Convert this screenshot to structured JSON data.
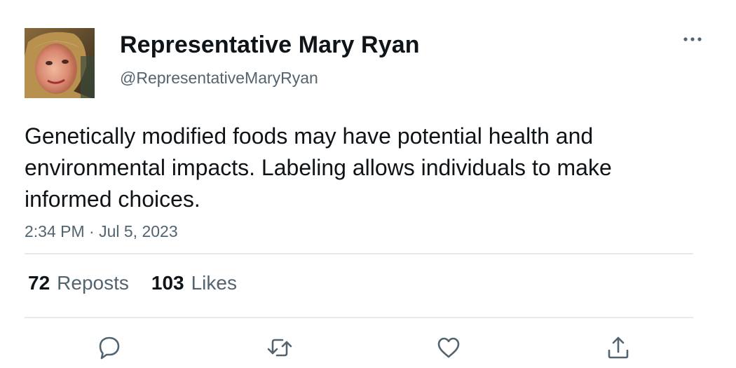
{
  "author": {
    "display_name": "Representative Mary Ryan",
    "handle": "@RepresentativeMaryRyan"
  },
  "tweet": {
    "text": "Genetically modified foods may have potential health and environmental impacts. Labeling allows individuals to make informed choices.",
    "timestamp": "2:34 PM · Jul 5, 2023"
  },
  "stats": {
    "reposts_count": "72",
    "reposts_label": "Reposts",
    "likes_count": "103",
    "likes_label": "Likes"
  },
  "icons": {
    "more": "more-horizontal-icon",
    "reply": "reply-bubble-icon",
    "repost": "repost-arrows-icon",
    "like": "heart-icon",
    "share": "share-upload-icon"
  },
  "colors": {
    "text_primary": "#0f1419",
    "text_secondary": "#536471",
    "divider": "#e6e9eb"
  }
}
